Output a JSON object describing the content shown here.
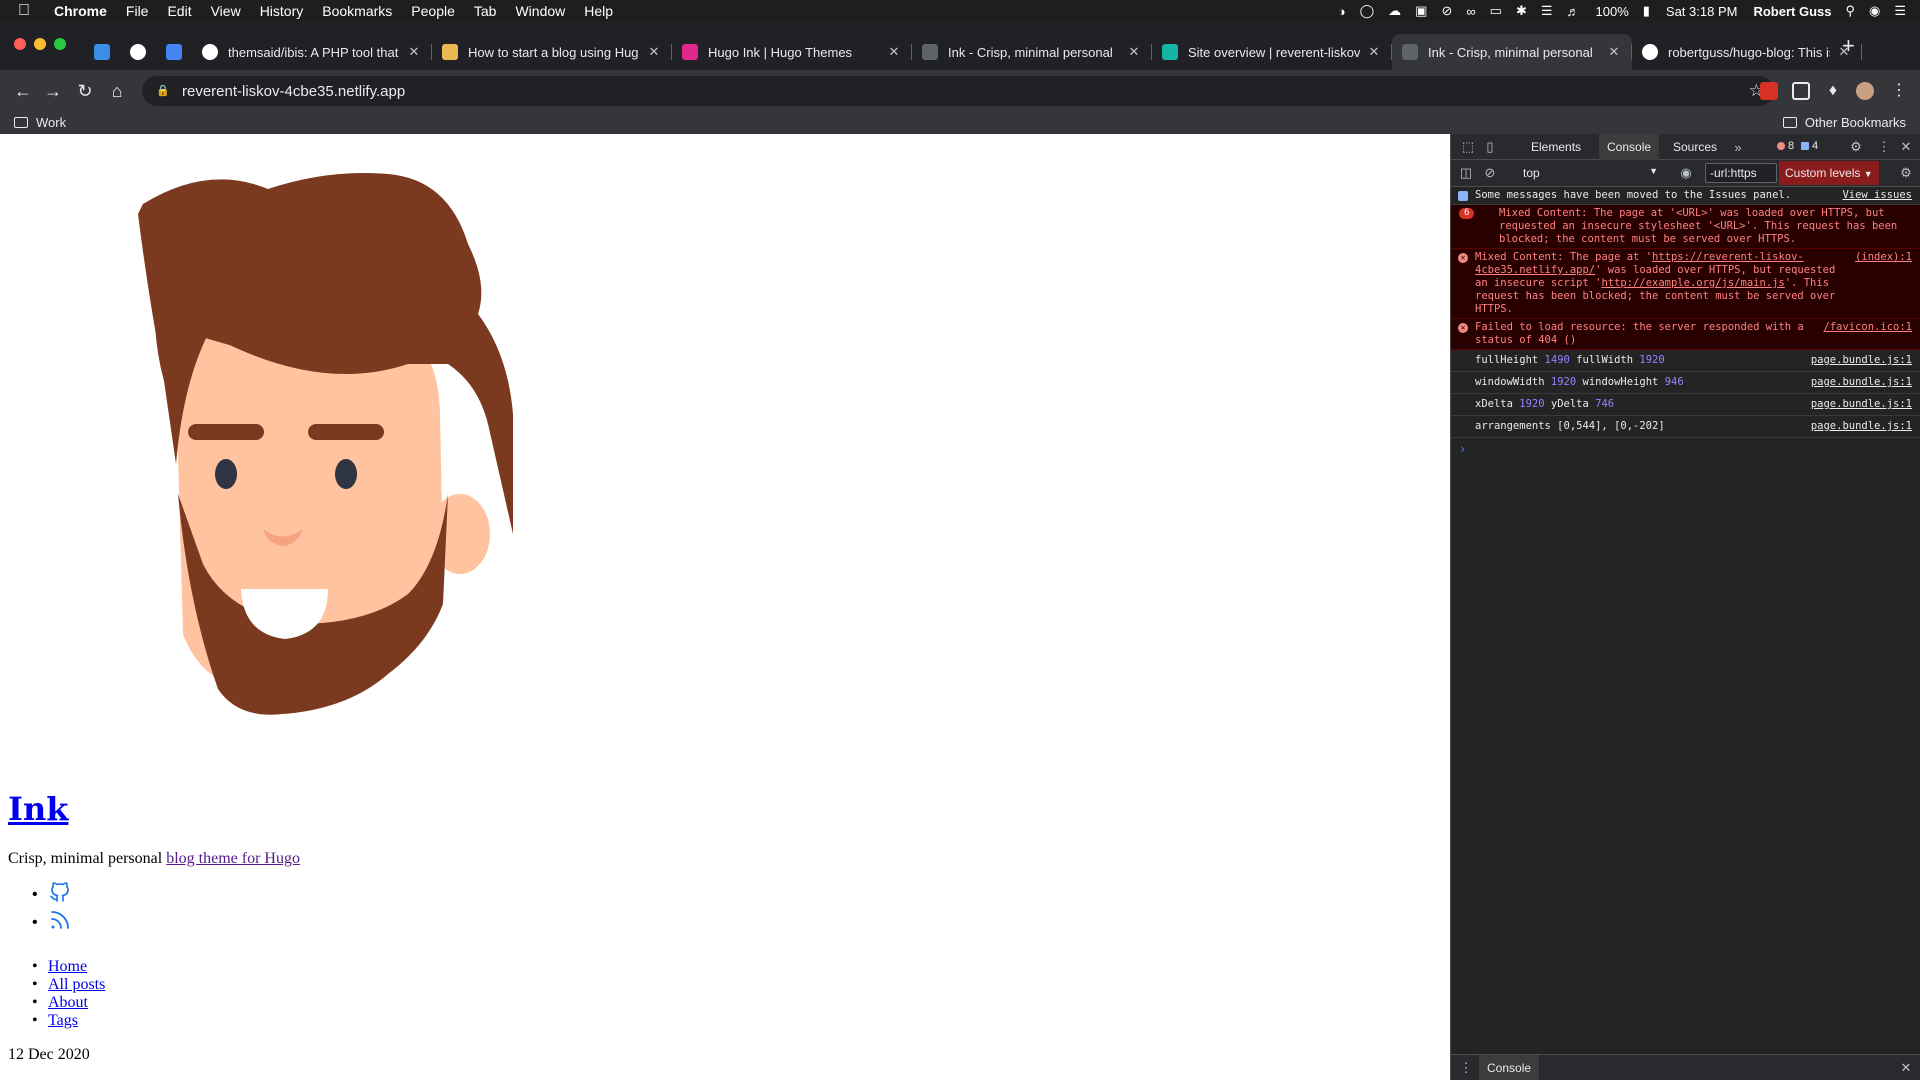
{
  "menubar": {
    "app": "Chrome",
    "items": [
      "File",
      "Edit",
      "View",
      "History",
      "Bookmarks",
      "People",
      "Tab",
      "Window",
      "Help"
    ],
    "battery": "100%",
    "clock": "Sat 3:18 PM",
    "user": "Robert Guss"
  },
  "tabs": [
    {
      "title": "",
      "icon": "pinned-diamond-icon",
      "color": "#3b8ee8"
    },
    {
      "title": "",
      "icon": "gmail-icon",
      "color": "#ffffff"
    },
    {
      "title": "",
      "icon": "calendar-icon",
      "color": "#4285f4"
    },
    {
      "title": "themsaid/ibis: A PHP tool that",
      "icon": "github-icon",
      "color": "#ffffff"
    },
    {
      "title": "How to start a blog using Hug",
      "icon": "hugo-icon",
      "color": "#ebb951"
    },
    {
      "title": "Hugo Ink | Hugo Themes",
      "icon": "hugo-themes-icon",
      "color": "#e0278a"
    },
    {
      "title": "Ink - Crisp, minimal personal",
      "icon": "globe-icon",
      "color": "#5f6368"
    },
    {
      "title": "Site overview | reverent-liskov",
      "icon": "netlify-icon",
      "color": "#15b5a4"
    },
    {
      "title": "Ink - Crisp, minimal personal",
      "icon": "globe-icon",
      "color": "#5f6368"
    },
    {
      "title": "robertguss/hugo-blog: This is",
      "icon": "github-icon",
      "color": "#ffffff"
    }
  ],
  "active_tab_index": 8,
  "toolbar": {
    "url": "reverent-liskov-4cbe35.netlify.app"
  },
  "bookmarks": {
    "work": "Work",
    "other": "Other Bookmarks"
  },
  "page": {
    "site_title": "Ink",
    "desc_text": "Crisp, minimal personal ",
    "desc_link": "blog theme for Hugo",
    "nav": [
      {
        "label": "Home"
      },
      {
        "label": "All posts"
      },
      {
        "label": "About"
      },
      {
        "label": "Tags"
      }
    ],
    "date": "12 Dec 2020"
  },
  "devtools": {
    "tabs": [
      "Elements",
      "Console",
      "Sources"
    ],
    "active_tab": "Console",
    "error_count": "8",
    "info_count": "4",
    "context": "top",
    "filter_value": "-url:https",
    "levels": "Custom levels",
    "drawer_tab": "Console",
    "messages": [
      {
        "type": "info",
        "text": "Some messages have been moved to the Issues panel.",
        "link": "View issues"
      },
      {
        "type": "error",
        "repeat": "6",
        "text": "Mixed Content: The page at '<URL>' was loaded over HTTPS, but requested an insecure stylesheet '<URL>'. This request has been blocked; the content must be served over HTTPS.",
        "source": ""
      },
      {
        "type": "error",
        "text_pre": "Mixed Content: The page at '",
        "link1": "https://reverent-liskov-4cbe35.netlify.app/",
        "text_mid": "' was loaded over HTTPS, but requested an insecure script '",
        "link2": "http://example.org/js/main.js",
        "text_post": "'. This request has been blocked; the content must be served over HTTPS.",
        "source": "(index):1"
      },
      {
        "type": "error",
        "text": "Failed to load resource: the server responded with a status of 404 ()",
        "source": "/favicon.ico:1"
      },
      {
        "type": "log",
        "parts": [
          "fullHeight",
          "1490",
          "fullWidth",
          "1920"
        ],
        "source": "page.bundle.js:1"
      },
      {
        "type": "log",
        "parts": [
          "windowWidth",
          "1920",
          "windowHeight",
          "946"
        ],
        "source": "page.bundle.js:1"
      },
      {
        "type": "log",
        "parts": [
          "xDelta",
          "1920",
          "yDelta",
          "746"
        ],
        "source": "page.bundle.js:1"
      },
      {
        "type": "log",
        "text": "arrangements [0,544], [0,-202]",
        "source": "page.bundle.js:1"
      }
    ]
  }
}
